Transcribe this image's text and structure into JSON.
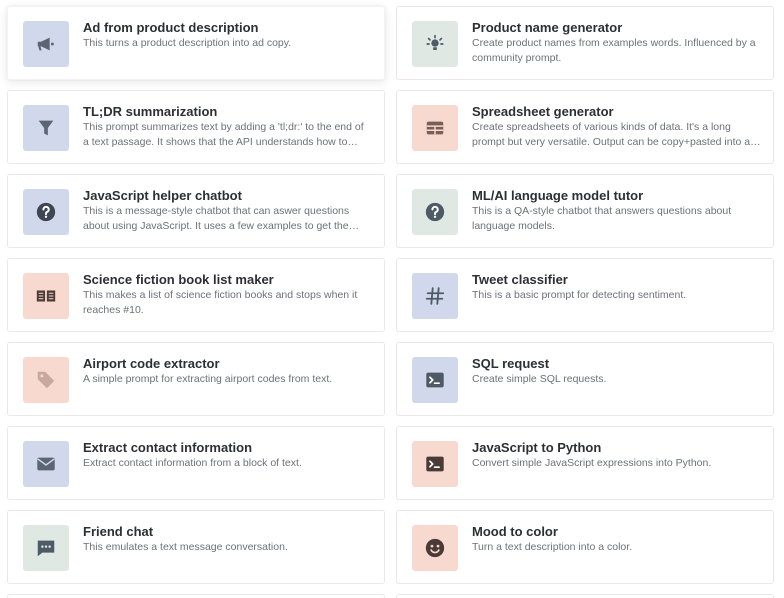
{
  "cards": [
    {
      "title": "Ad from product description",
      "desc": "This turns a product description into ad copy.",
      "icon": "megaphone-icon",
      "bg": "#d2d8eb",
      "fg": "#5b6574"
    },
    {
      "title": "Product name generator",
      "desc": "Create product names from examples words. Influenced by a community prompt.",
      "icon": "lightbulb-icon",
      "bg": "#dfe8e3",
      "fg": "#4e5a66"
    },
    {
      "title": "TL;DR summarization",
      "desc": "This prompt summarizes text by adding a 'tl;dr:' to the end of a text passage. It shows that the API understands how to perform a number of tasks with no instructions.",
      "icon": "funnel-icon",
      "bg": "#d2d8eb",
      "fg": "#5b6574"
    },
    {
      "title": "Spreadsheet generator",
      "desc": "Create spreadsheets of various kinds of data. It's a long prompt but very versatile. Output can be copy+pasted into a text file and saved as a .csv with pipe separators.",
      "icon": "table-icon",
      "bg": "#f8d9cf",
      "fg": "#7a5f58"
    },
    {
      "title": "JavaScript helper chatbot",
      "desc": "This is a message-style chatbot that can aswer questions about using JavaScript. It uses a few examples to get the conversation started.",
      "icon": "question-circle-icon",
      "bg": "#d2d8eb",
      "fg": "#3f4653"
    },
    {
      "title": "ML/AI language model tutor",
      "desc": "This is a QA-style chatbot that answers questions about language models.",
      "icon": "question-circle-icon",
      "bg": "#dfe8e3",
      "fg": "#4e5a66"
    },
    {
      "title": "Science fiction book list maker",
      "desc": "This makes a list of science fiction books and stops when it reaches #10.",
      "icon": "book-icon",
      "bg": "#f8d9cf",
      "fg": "#4a3b37"
    },
    {
      "title": "Tweet classifier",
      "desc": "This is a basic prompt for detecting sentiment.",
      "icon": "hashtag-icon",
      "bg": "#d2d8eb",
      "fg": "#4e5a66"
    },
    {
      "title": "Airport code extractor",
      "desc": "A simple prompt for extracting airport codes from text.",
      "icon": "tag-icon",
      "bg": "#f8d9cf",
      "fg": "#c9a99e"
    },
    {
      "title": "SQL request",
      "desc": "Create simple SQL requests.",
      "icon": "terminal-icon",
      "bg": "#d2d8eb",
      "fg": "#4e5a66"
    },
    {
      "title": "Extract contact information",
      "desc": "Extract contact information from a block of text.",
      "icon": "envelope-icon",
      "bg": "#d2d8eb",
      "fg": "#5b6574"
    },
    {
      "title": "JavaScript to Python",
      "desc": "Convert simple JavaScript expressions into Python.",
      "icon": "terminal-icon",
      "bg": "#f8d9cf",
      "fg": "#4a3b37"
    },
    {
      "title": "Friend chat",
      "desc": "This emulates a text message conversation.",
      "icon": "chat-bubble-icon",
      "bg": "#dfe8e3",
      "fg": "#4e5a66"
    },
    {
      "title": "Mood to color",
      "desc": "Turn a text description into a color.",
      "icon": "smiley-icon",
      "bg": "#f8d9cf",
      "fg": "#4a3b37"
    }
  ]
}
